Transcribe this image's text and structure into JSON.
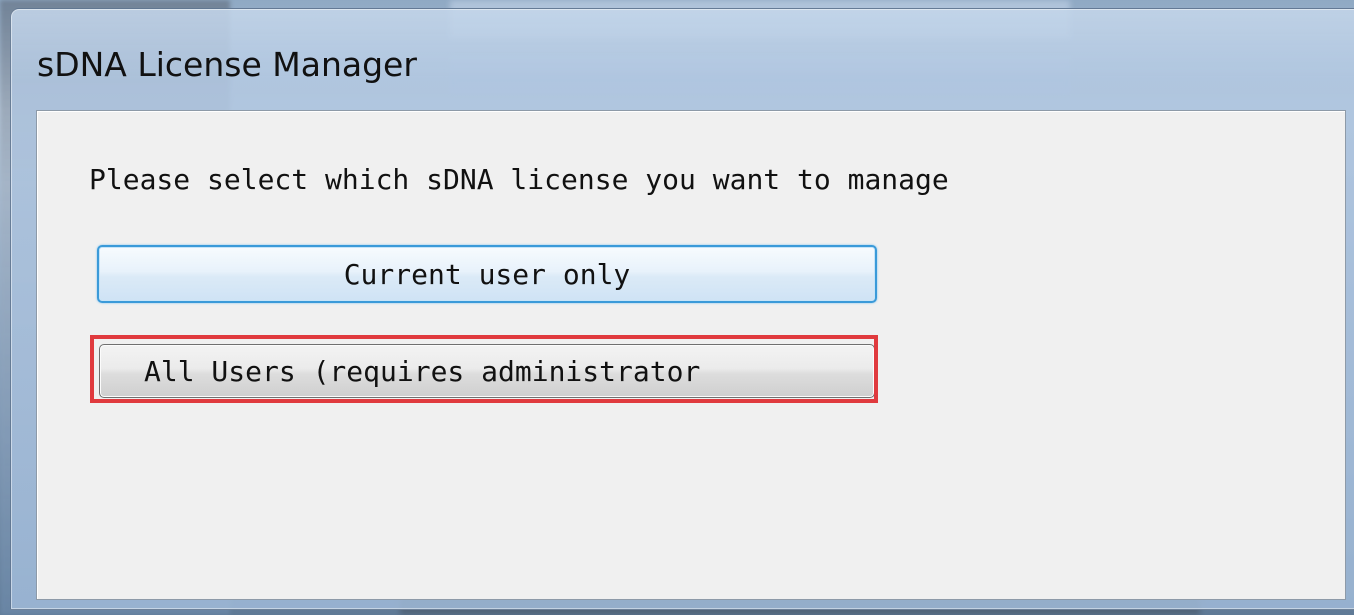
{
  "window": {
    "title": "sDNA License Manager"
  },
  "dialog": {
    "prompt": "Please select which sDNA license you want to manage",
    "buttons": {
      "current_user": "Current user only",
      "all_users": "All Users (requires administrator"
    }
  },
  "colors": {
    "highlight_border": "#e03a3e",
    "focus_border": "#3a9ad9",
    "client_background": "#f0f0f0"
  }
}
